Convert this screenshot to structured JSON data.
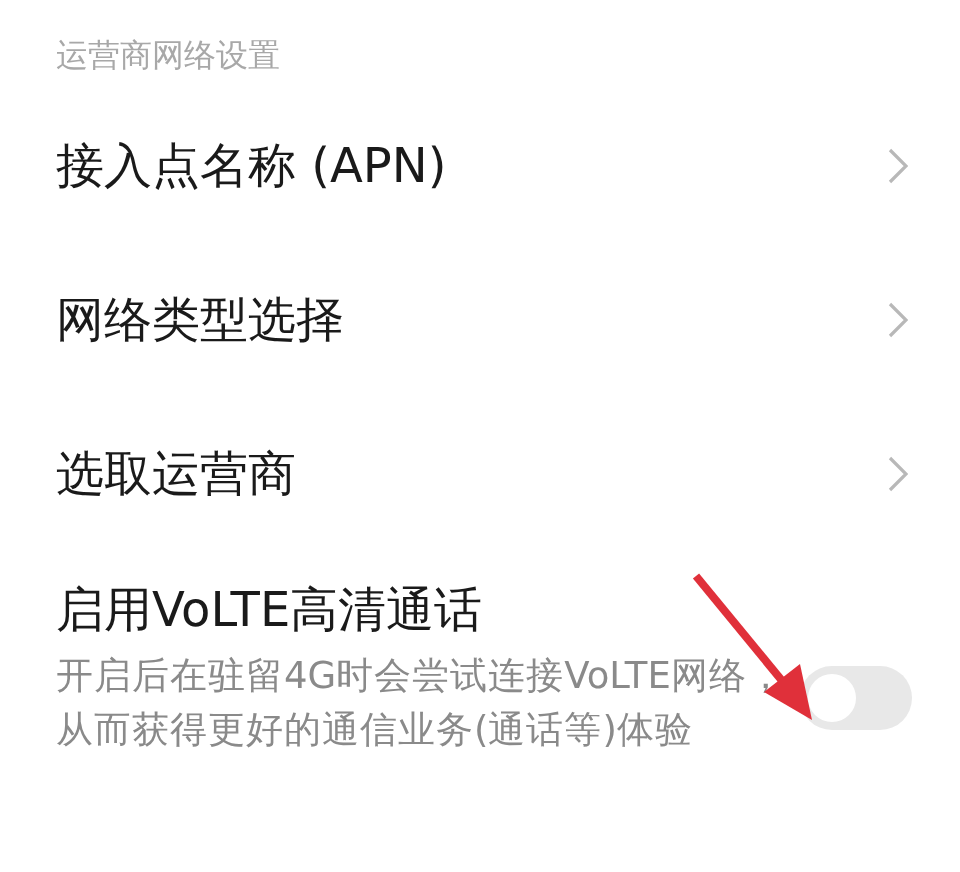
{
  "section_header": "运营商网络设置",
  "rows": [
    {
      "label": "接入点名称 (APN)"
    },
    {
      "label": "网络类型选择"
    },
    {
      "label": "选取运营商"
    }
  ],
  "volte": {
    "title": "启用VoLTE高清通话",
    "description": "开启后在驻留4G时会尝试连接VoLTE网络，从而获得更好的通信业务(通话等)体验",
    "on": false
  }
}
